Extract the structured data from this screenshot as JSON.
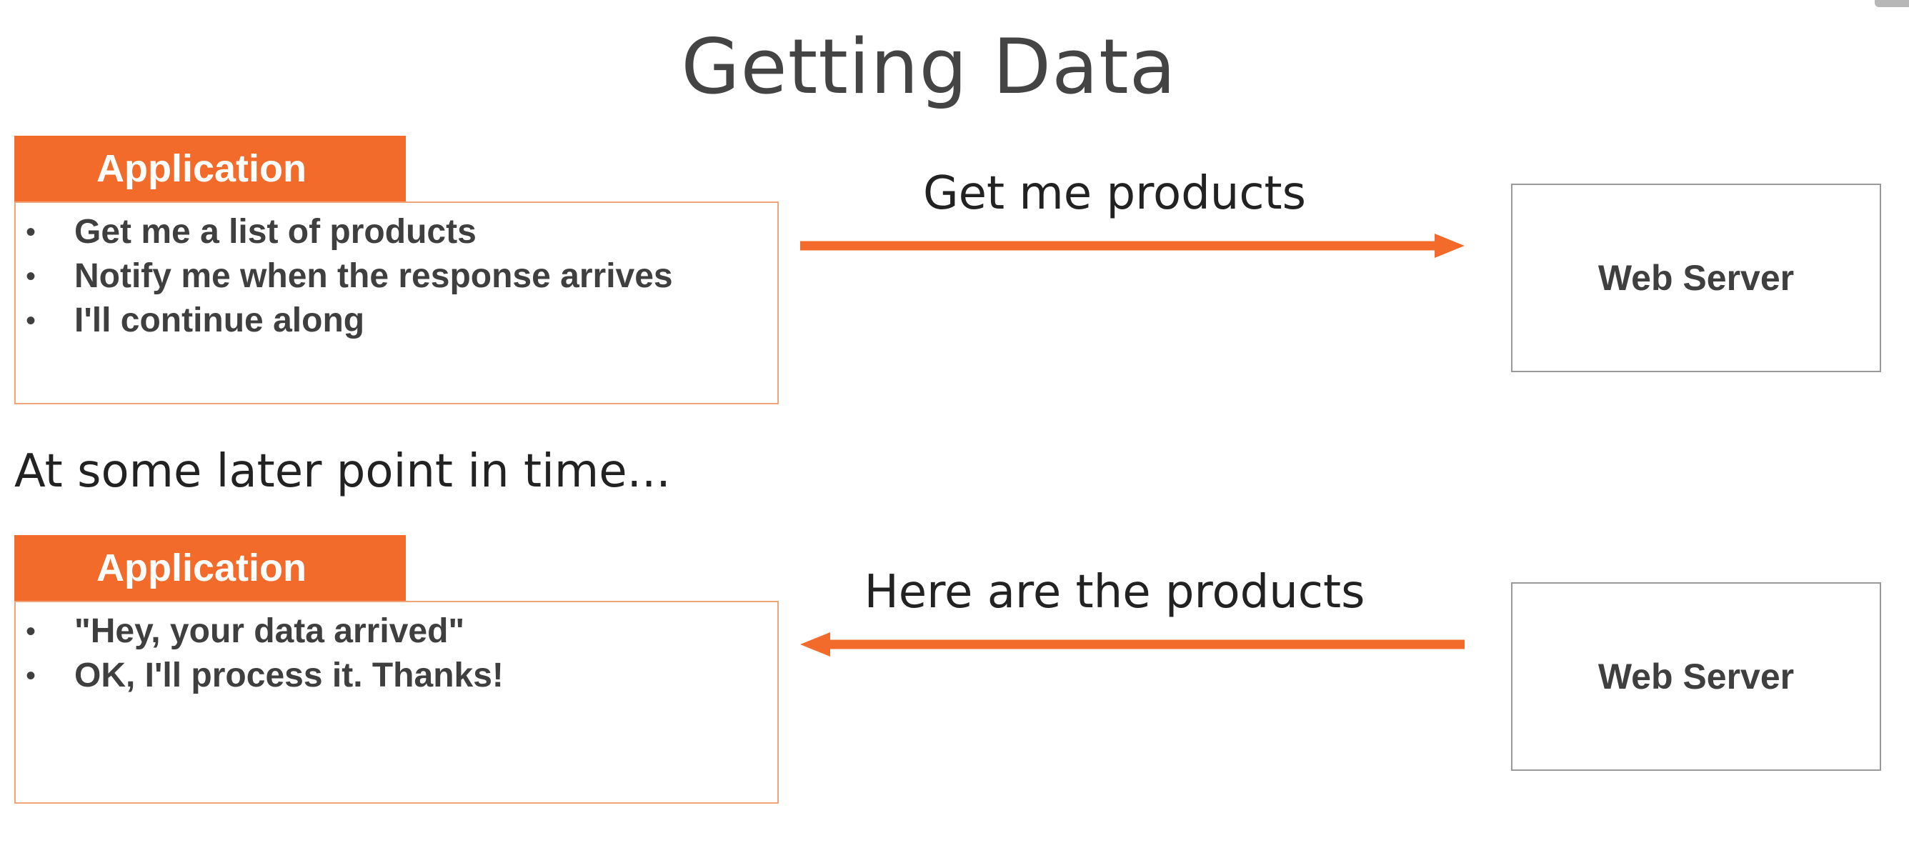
{
  "title": "Getting Data",
  "colors": {
    "accent": "#f26b2a",
    "app_border": "#f0a47a",
    "server_border": "#9a9a9a",
    "text": "#3f3f3f"
  },
  "top_row": {
    "application": {
      "header": "Application",
      "items": [
        "Get me a list of products",
        "Notify me when the response arrives",
        "I'll continue along"
      ]
    },
    "arrow": {
      "label": "Get me products",
      "direction": "right"
    },
    "server": {
      "label": "Web Server"
    }
  },
  "separator_text": "At some later point in time...",
  "bottom_row": {
    "application": {
      "header": "Application",
      "items": [
        "\"Hey, your data arrived\"",
        "OK, I'll process it. Thanks!"
      ]
    },
    "arrow": {
      "label": "Here are the products",
      "direction": "left"
    },
    "server": {
      "label": "Web Server"
    }
  }
}
